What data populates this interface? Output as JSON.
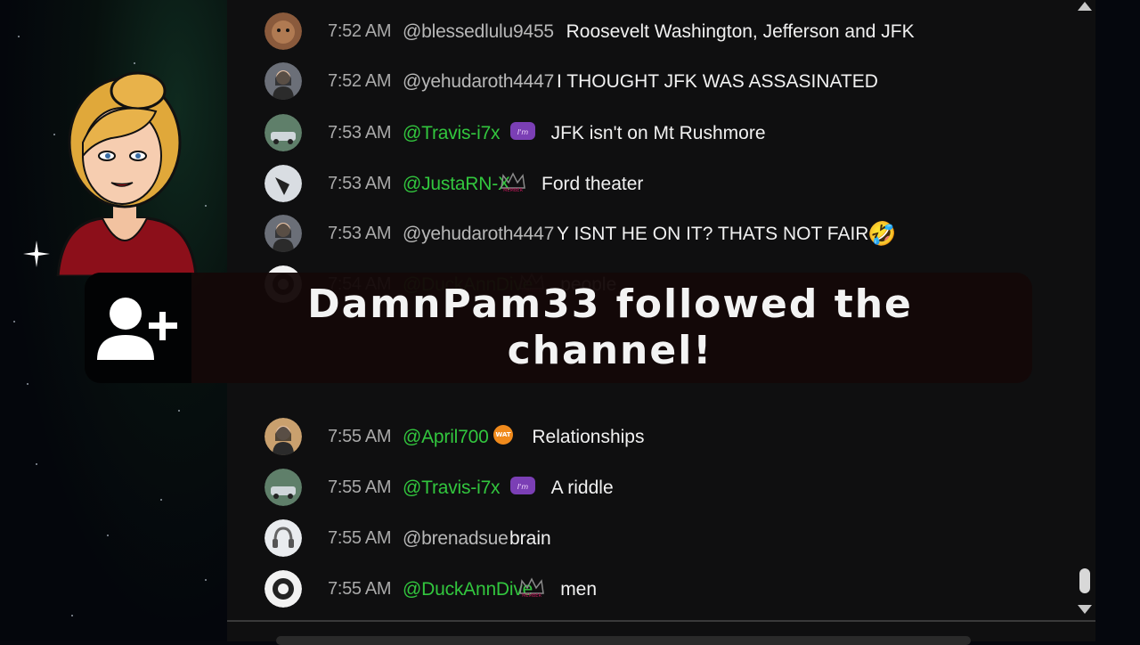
{
  "alert": {
    "icon": "user-plus-icon",
    "text": "DamnPam33 followed the channel!"
  },
  "messages": [
    {
      "time": "7:52 AM",
      "user": "@blessedlulu9455",
      "user_color": "grey",
      "text": "Roosevelt Washington, Jefferson and JFK",
      "avatar": "dog-avatar"
    },
    {
      "time": "7:52 AM",
      "user": "@yehudaroth4447",
      "user_color": "grey",
      "text": "I THOUGHT JFK WAS ASSASINATED",
      "avatar": "woman-avatar"
    },
    {
      "time": "7:53 AM",
      "user": "@Travis-i7x",
      "user_color": "green",
      "text": "JFK isn't on Mt Rushmore",
      "avatar": "car-avatar",
      "badge": "member-badge"
    },
    {
      "time": "7:53 AM",
      "user": "@JustaRN-X",
      "user_color": "green",
      "text": "Ford theater",
      "avatar": "bird-avatar",
      "badge": "crown-badge"
    },
    {
      "time": "7:53 AM",
      "user": "@yehudaroth4447",
      "user_color": "grey",
      "text": "Y ISNT HE ON IT? THATS NOT FAIR",
      "avatar": "woman-avatar",
      "emoji": "🤣"
    },
    {
      "time": "7:54 AM",
      "user": "@DuckAnnDive",
      "user_color": "green",
      "text": "people",
      "avatar": "logo-avatar",
      "badge": "crown-badge"
    },
    {
      "time": "7:55 AM",
      "user": "@April700",
      "user_color": "green",
      "text": "Relationships",
      "avatar": "woman2-avatar",
      "badge": "wat-badge"
    },
    {
      "time": "7:55 AM",
      "user": "@Travis-i7x",
      "user_color": "green",
      "text": "A riddle",
      "avatar": "car-avatar",
      "badge": "member-badge"
    },
    {
      "time": "7:55 AM",
      "user": "@brenadsue",
      "user_color": "grey",
      "text": "brain",
      "avatar": "headphones-avatar"
    },
    {
      "time": "7:55 AM",
      "user": "@DuckAnnDive",
      "user_color": "green",
      "text": "men",
      "avatar": "logo-avatar",
      "badge": "crown-badge"
    }
  ],
  "colors": {
    "chat_bg": "#0f0f10",
    "member_name": "#32c63e",
    "regular_name": "#b8b8b8",
    "timestamp": "#a9a9a9"
  }
}
